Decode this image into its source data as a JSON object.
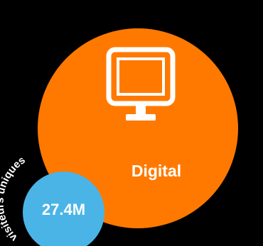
{
  "category": {
    "label": "Digital",
    "icon": "monitor-icon",
    "color": "#ff7900"
  },
  "stat": {
    "value": "27.4M",
    "caption": "visiteurs uniques",
    "color": "#4bb4e6"
  },
  "background": "#000000"
}
